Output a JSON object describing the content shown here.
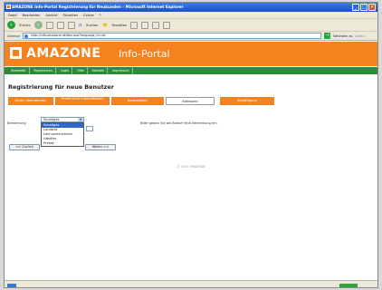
{
  "window": {
    "title": "AMAZONE Info-Portal Registrierung für Neukunden - Microsoft Internet Explorer",
    "controls": [
      "_",
      "□",
      "✕"
    ]
  },
  "menu": [
    "Datei",
    "Bearbeiten",
    "Ansicht",
    "Favoriten",
    "Extras",
    "?"
  ],
  "toolbar": {
    "back_label": "Zurück",
    "search_label": "Suchen",
    "favorites_label": "Favoriten"
  },
  "address": {
    "label": "Adresse",
    "url": "http://info.amazone.de/des.asp?language_id=de",
    "go": "→",
    "links": "Wechseln zu",
    "extra": "Links »"
  },
  "site": {
    "brand": "AMAZONE",
    "portal": "Info-Portal",
    "nav": [
      "Startseite",
      "Registrieren",
      "Login",
      "Hilfe",
      "Kontakt",
      "Impressum"
    ]
  },
  "page": {
    "title": "Registrierung für neue Benutzer",
    "steps": [
      "Daten übernehmen",
      "Persönliche Informationen",
      "Adressdaten",
      "Kategorie",
      "Bestätigung"
    ],
    "field_label": "Bemerkung",
    "select_value": "Sonstiges",
    "options": [
      "Sonstiges",
      "Landwirt",
      "Lohnunternehmer",
      "Händler",
      "Presse"
    ],
    "selected_option_index": 0,
    "hint": "Bitte geben Sie bei Bedarf eine Bemerkung ein.",
    "back_button": "<< Zurück",
    "next_button": "Weiter >>",
    "footer": "© 2007 AMAZONE"
  }
}
